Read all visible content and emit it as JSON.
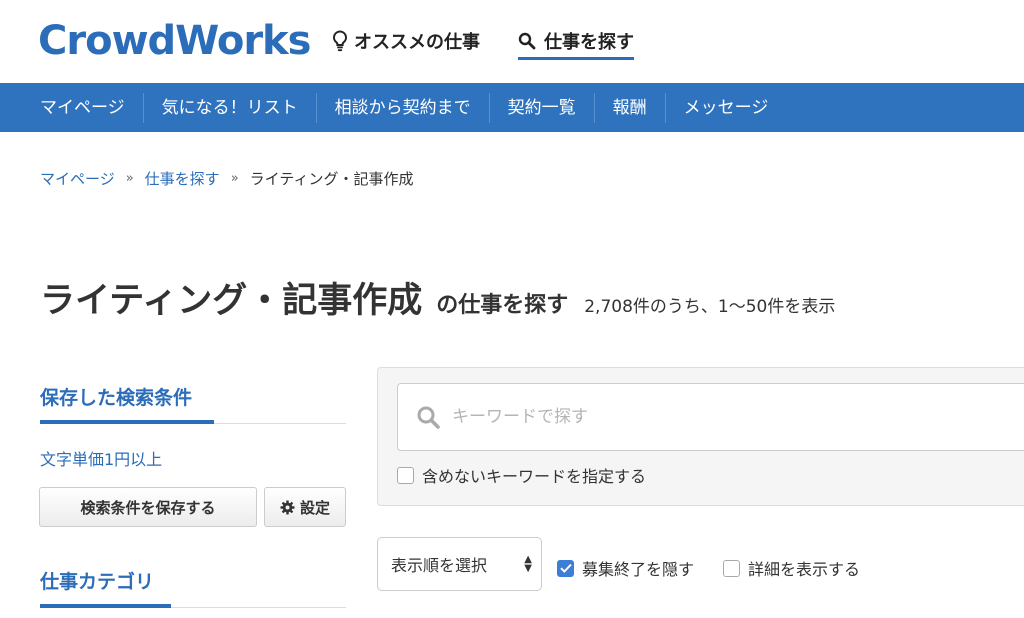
{
  "header": {
    "logo": "CrowdWorks",
    "recommend_label": "オススメの仕事",
    "search_label": "仕事を探す"
  },
  "nav": {
    "items": [
      {
        "label": "マイページ"
      },
      {
        "label": "気になる！リスト"
      },
      {
        "label": "相談から契約まで"
      },
      {
        "label": "契約一覧"
      },
      {
        "label": "報酬"
      },
      {
        "label": "メッセージ"
      }
    ]
  },
  "breadcrumb": {
    "items": [
      "マイページ",
      "仕事を探す"
    ],
    "separator": "»",
    "current": "ライティング・記事作成"
  },
  "page": {
    "title": "ライティング・記事作成",
    "subtitle": "の仕事を探す",
    "count": "2,708件のうち、1〜50件を表示"
  },
  "sidebar": {
    "saved_heading": "保存した検索条件",
    "saved_condition": "文字単価1円以上",
    "save_button": "検索条件を保存する",
    "settings_button": "設定",
    "category_heading": "仕事カテゴリ"
  },
  "search": {
    "keyword_placeholder": "キーワードで探す",
    "exclude_label": "含めないキーワードを指定する",
    "exclude_checked": false
  },
  "options": {
    "sort_label": "表示順を選択",
    "hide_closed_label": "募集終了を隠す",
    "hide_closed_checked": true,
    "show_details_label": "詳細を表示する",
    "show_details_checked": false
  },
  "colors": {
    "brand": "#2b6db8",
    "nav_bg": "#2f72bd",
    "checkbox_on": "#3d7fd6"
  }
}
